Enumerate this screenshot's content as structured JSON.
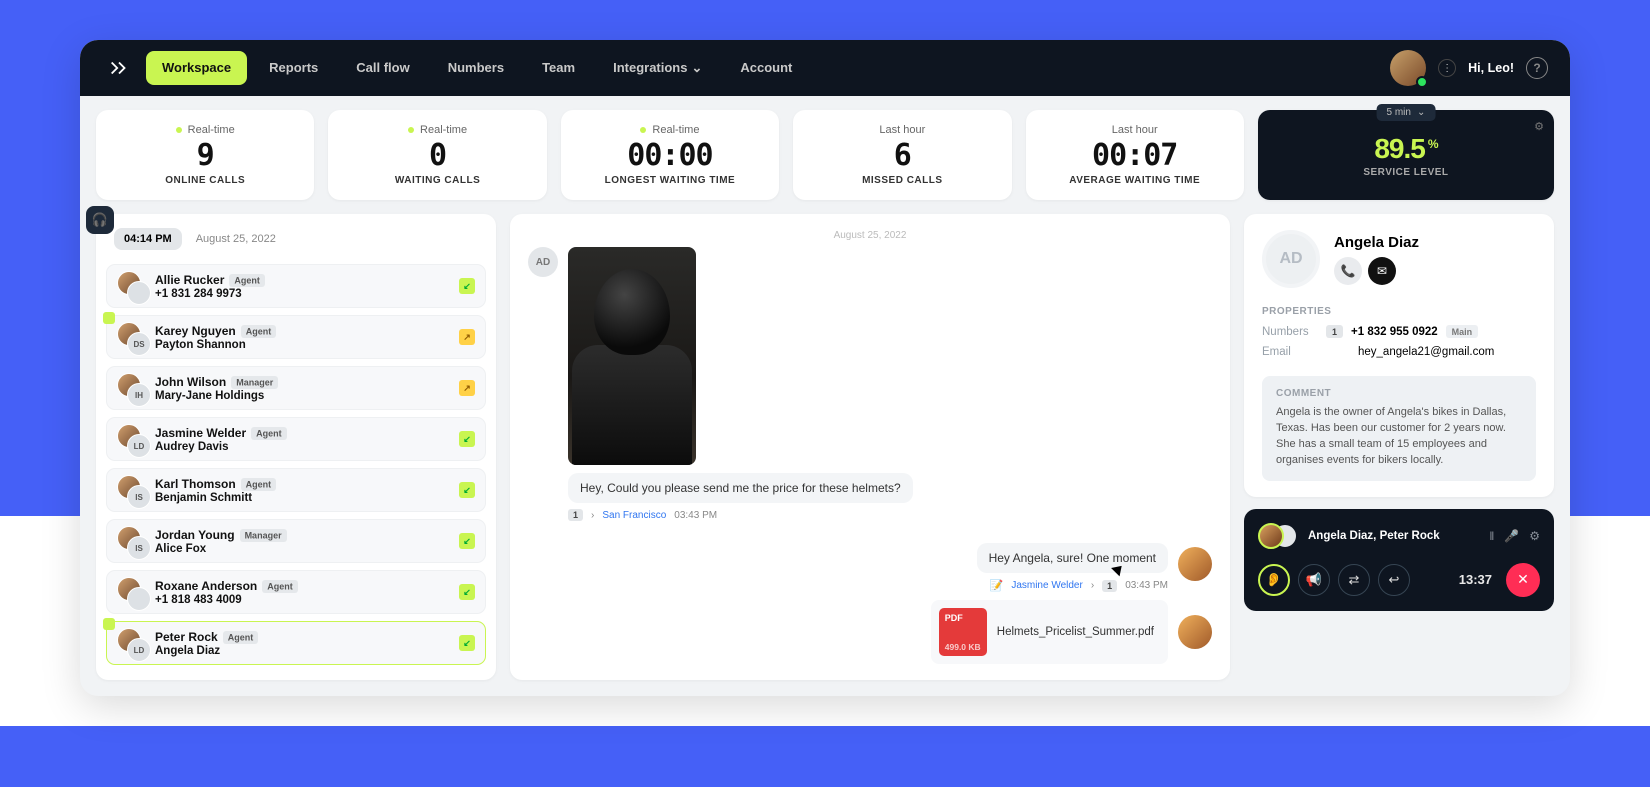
{
  "header": {
    "nav": [
      "Workspace",
      "Reports",
      "Call flow",
      "Numbers",
      "Team",
      "Integrations",
      "Account"
    ],
    "greet": "Hi, Leo!"
  },
  "stats": [
    {
      "period": "Real-time",
      "value": "9",
      "label": "ONLINE CALLS"
    },
    {
      "period": "Real-time",
      "value": "0",
      "label": "WAITING CALLS"
    },
    {
      "period": "Real-time",
      "value": "00:00",
      "label": "LONGEST WAITING TIME"
    },
    {
      "period": "Last hour",
      "value": "6",
      "label": "MISSED CALLS"
    },
    {
      "period": "Last hour",
      "value": "00:07",
      "label": "AVERAGE WAITING TIME"
    }
  ],
  "service": {
    "chip": "5 min",
    "value": "89.5",
    "unit": "%",
    "label": "SERVICE LEVEL"
  },
  "sidebar": {
    "time": "04:14 PM",
    "date": "August 25, 2022"
  },
  "convos": [
    {
      "name": "Allie Rucker",
      "role": "Agent",
      "sub": "+1 831 284 9973",
      "dir": "in",
      "sub2": "",
      "second": "",
      "flag": false
    },
    {
      "name": "Karey Nguyen",
      "role": "Agent",
      "sub": "Payton Shannon",
      "dir": "out",
      "second": "DS",
      "flag": true
    },
    {
      "name": "John Wilson",
      "role": "Manager",
      "sub": "Mary-Jane Holdings",
      "dir": "out",
      "second": "IH",
      "flag": false
    },
    {
      "name": "Jasmine Welder",
      "role": "Agent",
      "sub": "Audrey Davis",
      "dir": "in",
      "second": "LD",
      "flag": false
    },
    {
      "name": "Karl Thomson",
      "role": "Agent",
      "sub": "Benjamin Schmitt",
      "dir": "in",
      "second": "IS",
      "flag": false
    },
    {
      "name": "Jordan Young",
      "role": "Manager",
      "sub": "Alice Fox",
      "dir": "in",
      "second": "IS",
      "flag": false
    },
    {
      "name": "Roxane Anderson",
      "role": "Agent",
      "sub": "+1 818 483 4009",
      "dir": "in",
      "second": "",
      "flag": false
    },
    {
      "name": "Peter Rock",
      "role": "Agent",
      "sub": "Angela Diaz",
      "dir": "in",
      "second": "LD",
      "flag": true
    }
  ],
  "chat": {
    "date": "August 25, 2022",
    "msg1": {
      "avatar": "AD",
      "text": "Hey, Could you please send me the price for these helmets?",
      "loc": "San Francisco",
      "num": "1",
      "time": "03:43 PM"
    },
    "msg2": {
      "text": "Hey Angela, sure! One moment",
      "name": "Jasmine Welder",
      "num": "1",
      "time": "03:43 PM"
    },
    "file": {
      "name": "Helmets_Pricelist_Summer.pdf",
      "size": "499.0 KB"
    }
  },
  "profile": {
    "initials": "AD",
    "name": "Angela Diaz",
    "props_h": "PROPERTIES",
    "numbers_k": "Numbers",
    "numbers_badge": "1",
    "numbers_v": "+1 832 955 0922",
    "numbers_tag": "Main",
    "email_k": "Email",
    "email_v": "hey_angela21@gmail.com",
    "comment_h": "COMMENT",
    "comment": "Angela is the owner of Angela's bikes in Dallas, Texas. Has been our customer for 2 years now. She has a small team of 15 employees and organises events for bikers locally."
  },
  "call": {
    "names": "Angela Diaz, Peter Rock",
    "time": "13:37"
  }
}
